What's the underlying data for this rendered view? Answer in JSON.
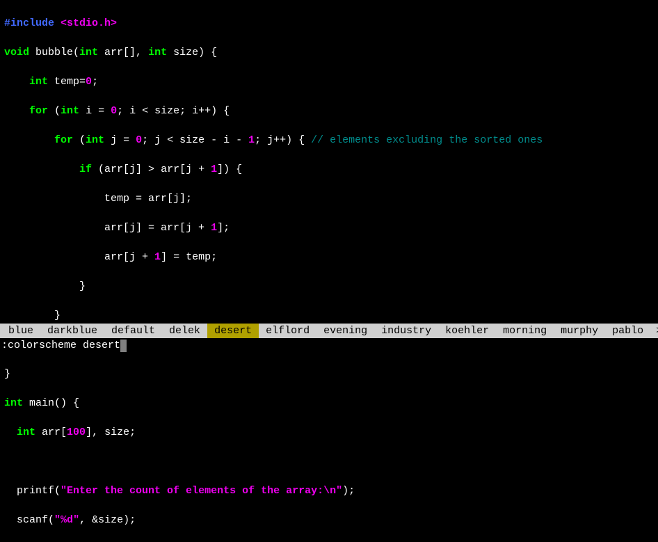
{
  "code": {
    "l1_include": "#include",
    "l1_file": "<stdio.h>",
    "l2_void": "void",
    "l2_fname": " bubble(",
    "l2_int": "int",
    "l2_arr": " arr[], ",
    "l2_int2": "int",
    "l2_size": " size) {",
    "l3_int": "int",
    "l3_rest": " temp=",
    "l3_zero": "0",
    "l3_semi": ";",
    "l4_for": "for",
    "l4_open": " (",
    "l4_int": "int",
    "l4_iinit": " i = ",
    "l4_zero": "0",
    "l4_cond": "; i < size; i++) {",
    "l5_for": "for",
    "l5_open": " (",
    "l5_int": "int",
    "l5_jinit": " j = ",
    "l5_zero": "0",
    "l5_mid": "; j < size - i - ",
    "l5_one": "1",
    "l5_close": "; j++) { ",
    "l5_comment": "// elements excluding the sorted ones",
    "l6_if": "if",
    "l6_cond": " (arr[j] > arr[j + ",
    "l6_one": "1",
    "l6_close": "]) {",
    "l7": "temp = arr[j];",
    "l8_a": "arr[j] = arr[j + ",
    "l8_one": "1",
    "l8_b": "];",
    "l9_a": "arr[j + ",
    "l9_one": "1",
    "l9_b": "] = temp;",
    "l10": "}",
    "l11": "}",
    "l12": "}",
    "l13": "}",
    "l14_int": "int",
    "l14_main": " main() {",
    "l15_int": "int",
    "l15_arr": " arr[",
    "l15_hundred": "100",
    "l15_rest": "], size;",
    "l17_a": "printf(",
    "l17_str": "\"Enter the count of elements of the array:",
    "l17_esc": "\\n",
    "l17_strend": "\"",
    "l17_b": ");",
    "l18_a": "scanf(",
    "l18_str": "\"",
    "l18_fmt": "%d",
    "l18_strend": "\"",
    "l18_b": ", &size);"
  },
  "completion": {
    "items": [
      {
        "label": "blue",
        "selected": false
      },
      {
        "label": "darkblue",
        "selected": false
      },
      {
        "label": "default",
        "selected": false
      },
      {
        "label": "delek",
        "selected": false
      },
      {
        "label": "desert",
        "selected": true
      },
      {
        "label": "elflord",
        "selected": false
      },
      {
        "label": "evening",
        "selected": false
      },
      {
        "label": "industry",
        "selected": false
      },
      {
        "label": "koehler",
        "selected": false
      },
      {
        "label": "morning",
        "selected": false
      },
      {
        "label": "murphy",
        "selected": false
      },
      {
        "label": "pablo",
        "selected": false
      }
    ],
    "more": ">"
  },
  "command": ":colorscheme desert"
}
